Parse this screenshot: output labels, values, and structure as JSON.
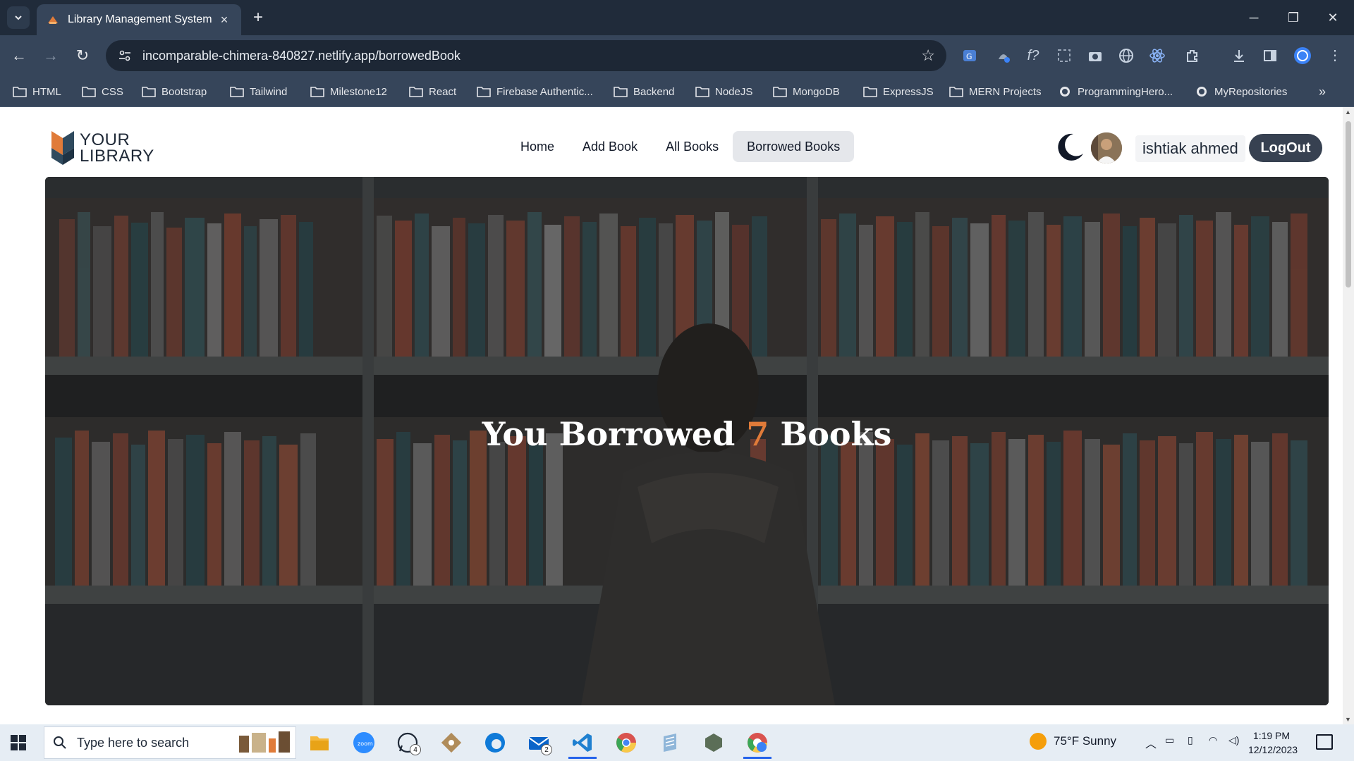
{
  "browser": {
    "tab_title": "Library Management System",
    "url": "incomparable-chimera-840827.netlify.app/borrowedBook",
    "bookmarks": [
      "HTML",
      "CSS",
      "Bootstrap",
      "Tailwind",
      "Milestone12",
      "React",
      "Firebase Authentic...",
      "Backend",
      "NodeJS",
      "MongoDB",
      "ExpressJS",
      "MERN Projects",
      "ProgrammingHero...",
      "MyRepositories"
    ]
  },
  "site": {
    "logo_line1": "YOUR",
    "logo_line2": "LIBRARY",
    "nav": [
      "Home",
      "Add Book",
      "All Books",
      "Borrowed Books"
    ],
    "active_nav": "Borrowed Books",
    "username": "ishtiak ahmed",
    "logout_label": "LogOut",
    "theme_icon": "moon-icon"
  },
  "hero": {
    "title_prefix": "You Borrowed",
    "count": "7",
    "title_suffix": "Books",
    "accent_color": "#e07b39"
  },
  "taskbar": {
    "search_placeholder": "Type here to search",
    "whatsapp_badge": "4",
    "mail_badge": "2",
    "weather": "75°F  Sunny",
    "time": "1:19 PM",
    "date": "12/12/2023"
  }
}
